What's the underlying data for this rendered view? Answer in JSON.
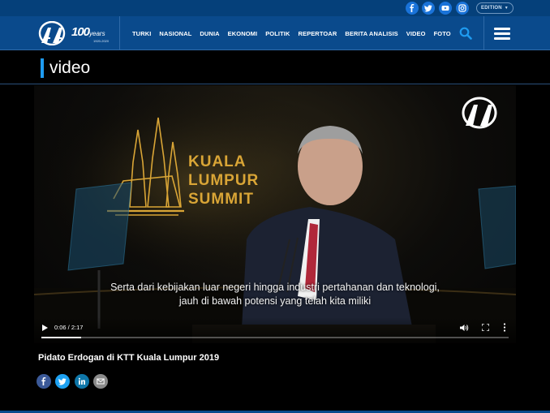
{
  "header": {
    "social_icons": [
      "facebook-icon",
      "twitter-icon",
      "youtube-icon",
      "instagram-icon"
    ],
    "edition_label": "EDITION",
    "logo_years": {
      "number": "100",
      "word": "years",
      "range": "1920-2020"
    },
    "menu": [
      "TURKI",
      "NASIONAL",
      "DUNIA",
      "EKONOMI",
      "POLITIK",
      "REPERTOAR",
      "BERITA ANALISIS",
      "VIDEO",
      "FOTO"
    ]
  },
  "section": {
    "title": "video"
  },
  "video": {
    "event_logo_lines": [
      "KUALA",
      "LUMPUR",
      "SUMMIT"
    ],
    "subtitle_lines": [
      "Serta dari kebijakan luar negeri hingga industri pertahanan dan teknologi,",
      "jauh di bawah potensi yang telah kita miliki"
    ],
    "time_display": "0:06 / 2:17",
    "progress_fraction": 0.044
  },
  "article": {
    "caption": "Pidato Erdogan di KTT Kuala Lumpur 2019"
  },
  "share_icons": [
    "facebook-icon",
    "twitter-icon",
    "linkedin-icon",
    "email-icon"
  ],
  "colors": {
    "nav_bg": "#0a4a8c",
    "topbar_bg": "#05407a",
    "accent_blue": "#1e9bf0",
    "summit_gold": "#d9a536",
    "share_facebook": "#3b5998",
    "share_twitter": "#1da1f2",
    "share_linkedin": "#0e76a8",
    "share_email": "#8a8a8a"
  }
}
